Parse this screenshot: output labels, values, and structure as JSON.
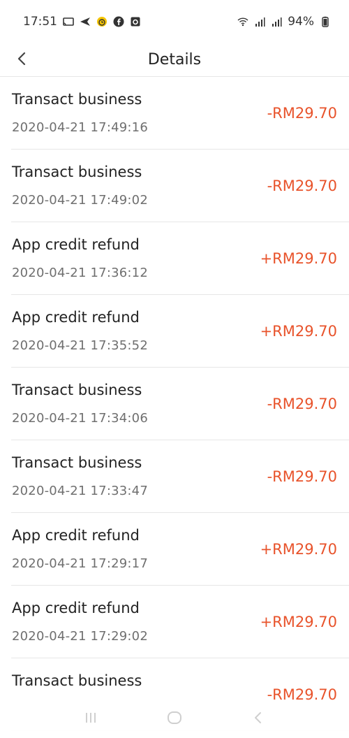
{
  "status_bar": {
    "time": "17:51",
    "battery": "94%",
    "icons_left": [
      "cast-icon",
      "send-icon",
      "alarm-app-icon",
      "facebook-icon",
      "camera-app-icon"
    ],
    "icons_right": [
      "wifi-icon",
      "signal-icon",
      "signal-icon",
      "battery-icon"
    ]
  },
  "header": {
    "title": "Details",
    "back_icon": "chevron-left-icon"
  },
  "colors": {
    "amount": "#e8532b",
    "divider": "#e6e6e6",
    "secondary_text": "#6f6f6f"
  },
  "transactions": [
    {
      "title": "Transact business",
      "time": "2020-04-21 17:49:16",
      "amount": "-RM29.70"
    },
    {
      "title": "Transact business",
      "time": "2020-04-21 17:49:02",
      "amount": "-RM29.70"
    },
    {
      "title": "App credit refund",
      "time": "2020-04-21 17:36:12",
      "amount": "+RM29.70"
    },
    {
      "title": "App credit refund",
      "time": "2020-04-21 17:35:52",
      "amount": "+RM29.70"
    },
    {
      "title": "Transact business",
      "time": "2020-04-21 17:34:06",
      "amount": "-RM29.70"
    },
    {
      "title": "Transact business",
      "time": "2020-04-21 17:33:47",
      "amount": "-RM29.70"
    },
    {
      "title": "App credit refund",
      "time": "2020-04-21 17:29:17",
      "amount": "+RM29.70"
    },
    {
      "title": "App credit refund",
      "time": "2020-04-21 17:29:02",
      "amount": "+RM29.70"
    },
    {
      "title": "Transact business",
      "time": "",
      "amount": "-RM29.70"
    }
  ],
  "nav_bar": {
    "icons": [
      "recent-apps-icon",
      "home-icon",
      "back-icon"
    ]
  }
}
